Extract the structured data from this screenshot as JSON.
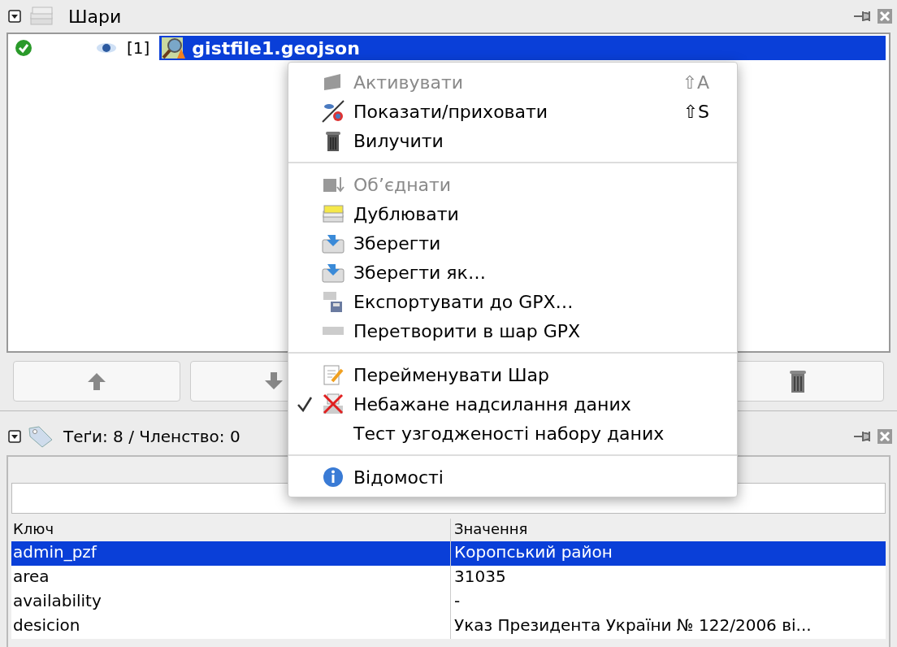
{
  "layers_panel": {
    "title": "Шари",
    "collapsed": false,
    "layers": [
      {
        "active": true,
        "visible": true,
        "index": "[1]",
        "name": "gistfile1.geojson",
        "selected": true
      }
    ],
    "buttons": [
      {
        "kind": "up",
        "disabled": false
      },
      {
        "kind": "down",
        "disabled": false
      },
      {
        "kind": "delete",
        "disabled": false
      }
    ]
  },
  "tags_panel": {
    "title": "Теґи: 8 / Членство: 0",
    "collapsed": false,
    "table": {
      "columns": [
        "Ключ",
        "Значення"
      ],
      "rows": [
        {
          "key": "admin_pzf",
          "value": "Коропський район",
          "selected": true
        },
        {
          "key": "area",
          "value": "31035",
          "selected": false
        },
        {
          "key": "availability",
          "value": "-",
          "selected": false
        },
        {
          "key": "desicion",
          "value": "Указ Президента України № 122/2006 ві...",
          "selected": false
        }
      ]
    }
  },
  "context_menu": {
    "items": [
      {
        "kind": "item",
        "label": "Активувати",
        "shortcut_symbol": "⇧",
        "shortcut_key": "A",
        "disabled": true,
        "checked": false
      },
      {
        "kind": "item",
        "label": "Показати/приховати",
        "shortcut_symbol": "⇧",
        "shortcut_key": "S",
        "disabled": false,
        "checked": false
      },
      {
        "kind": "item",
        "label": "Вилучити",
        "disabled": false,
        "checked": false
      },
      {
        "kind": "separator"
      },
      {
        "kind": "item",
        "label": "Об’єднати",
        "disabled": true,
        "checked": false
      },
      {
        "kind": "item",
        "label": "Дублювати",
        "disabled": false,
        "checked": false
      },
      {
        "kind": "item",
        "label": "Зберегти",
        "disabled": false,
        "checked": false
      },
      {
        "kind": "item",
        "label": "Зберегти як…",
        "disabled": false,
        "checked": false
      },
      {
        "kind": "item",
        "label": "Експортувати до GPX…",
        "disabled": false,
        "checked": false
      },
      {
        "kind": "item",
        "label": "Перетворити в шар GPX",
        "disabled": false,
        "checked": false
      },
      {
        "kind": "separator"
      },
      {
        "kind": "item",
        "label": "Перейменувати Шар",
        "disabled": false,
        "checked": false
      },
      {
        "kind": "item",
        "label": "Небажане надсилання даних",
        "disabled": false,
        "checked": true
      },
      {
        "kind": "item",
        "label": "Тест узгодженості набору даних",
        "disabled": false,
        "checked": false
      },
      {
        "kind": "separator"
      },
      {
        "kind": "item",
        "label": "Відомості",
        "disabled": false,
        "checked": false
      }
    ]
  }
}
